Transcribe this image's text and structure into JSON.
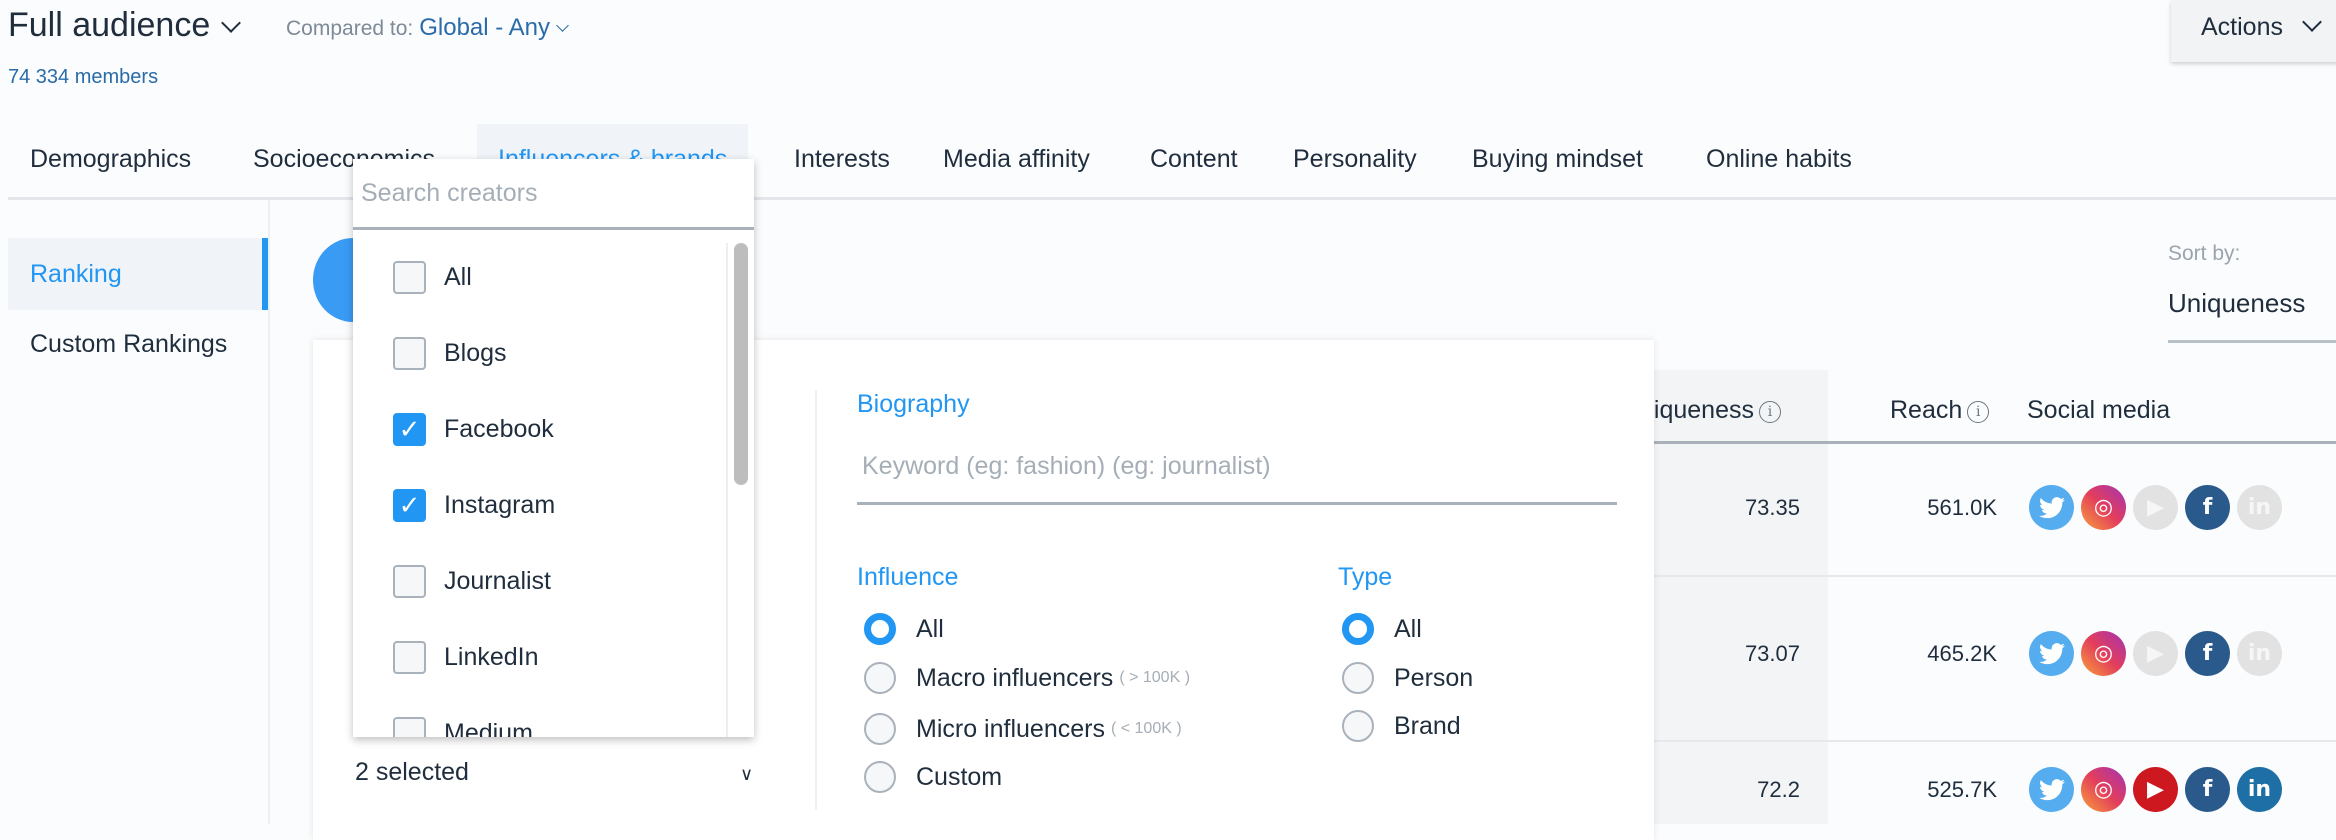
{
  "header": {
    "audience": "Full audience",
    "compared_label": "Compared to:",
    "compared_value": "Global - Any",
    "members": "74 334 members",
    "actions_label": "Actions"
  },
  "tabs": [
    "Demographics",
    "Socioeconomics",
    "Influencers & brands",
    "Interests",
    "Media affinity",
    "Content",
    "Personality",
    "Buying mindset",
    "Online habits"
  ],
  "active_tab": "Influencers & brands",
  "sidebar": {
    "items": [
      "Ranking",
      "Custom Rankings"
    ],
    "active": "Ranking"
  },
  "sort": {
    "label": "Sort by:",
    "value": "Uniqueness"
  },
  "dropdown": {
    "search_placeholder": "Search creators",
    "options": [
      {
        "label": "All",
        "checked": false
      },
      {
        "label": "Blogs",
        "checked": false
      },
      {
        "label": "Facebook",
        "checked": true
      },
      {
        "label": "Instagram",
        "checked": true
      },
      {
        "label": "Journalist",
        "checked": false
      },
      {
        "label": "LinkedIn",
        "checked": false
      },
      {
        "label": "Medium",
        "checked": false
      }
    ],
    "summary": "2 selected"
  },
  "filters": {
    "biography_label": "Biography",
    "keyword_placeholder": "Keyword (eg: fashion) (eg: journalist)",
    "influence_label": "Influence",
    "influence_options": [
      {
        "label": "All",
        "hint": "",
        "selected": true
      },
      {
        "label": "Macro influencers",
        "hint": "( > 100K )",
        "selected": false
      },
      {
        "label": "Micro influencers",
        "hint": "( < 100K )",
        "selected": false
      },
      {
        "label": "Custom",
        "hint": "",
        "selected": false
      }
    ],
    "type_label": "Type",
    "type_options": [
      {
        "label": "All",
        "selected": true
      },
      {
        "label": "Person",
        "selected": false
      },
      {
        "label": "Brand",
        "selected": false
      }
    ]
  },
  "table": {
    "headers": {
      "uniqueness": "niqueness",
      "reach": "Reach",
      "social": "Social media"
    },
    "rows": [
      {
        "uniqueness": "73.35",
        "reach": "561.0K",
        "social": {
          "twitter": true,
          "instagram": true,
          "youtube": false,
          "facebook": true,
          "linkedin": false
        }
      },
      {
        "uniqueness": "73.07",
        "reach": "465.2K",
        "social": {
          "twitter": true,
          "instagram": true,
          "youtube": false,
          "facebook": true,
          "linkedin": false
        }
      },
      {
        "uniqueness": "72.2",
        "reach": "525.7K",
        "social": {
          "twitter": true,
          "instagram": true,
          "youtube": true,
          "facebook": true,
          "linkedin": true
        }
      }
    ]
  },
  "colors": {
    "accent": "#2196f3",
    "twitter": "#55acee",
    "youtube": "#cc181e",
    "facebook": "#2a5a8c",
    "linkedin": "#1d6fa5",
    "inactive": "#e2e2e2"
  }
}
